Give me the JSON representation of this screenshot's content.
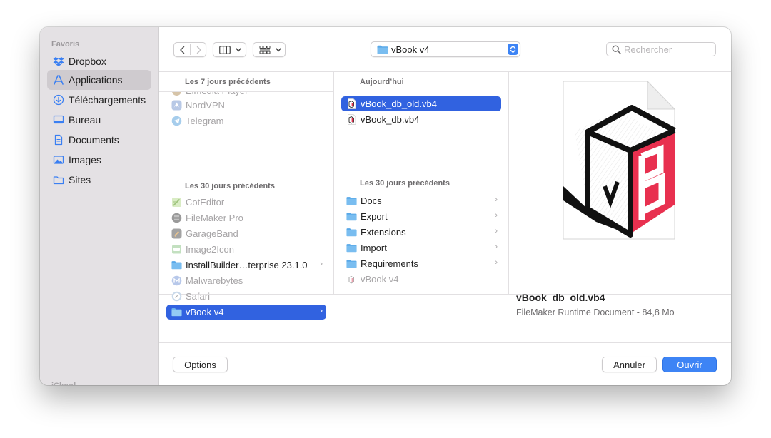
{
  "sidebar": {
    "header": "Favoris",
    "items": [
      {
        "label": "Dropbox",
        "icon": "dropbox-icon"
      },
      {
        "label": "Applications",
        "icon": "applications-icon",
        "selected": true
      },
      {
        "label": "Téléchargements",
        "icon": "downloads-icon"
      },
      {
        "label": "Bureau",
        "icon": "desktop-icon"
      },
      {
        "label": "Documents",
        "icon": "documents-icon"
      },
      {
        "label": "Images",
        "icon": "images-icon"
      },
      {
        "label": "Sites",
        "icon": "sites-folder-icon"
      }
    ],
    "next_header_partial": "iCloud"
  },
  "toolbar": {
    "back_icon": "chevron-left-icon",
    "forward_icon": "chevron-right-icon",
    "view_mode_icon": "columns-view-icon",
    "group_icon": "group-grid-icon",
    "path_label": "vBook v4",
    "search_placeholder": "Rechercher"
  },
  "column1": {
    "partial_item": "Elmedia Player",
    "section1": "Les 7 jours précédents",
    "recent_items": [
      {
        "label": "NordVPN",
        "icon": "nordvpn-app-icon",
        "dim": true
      },
      {
        "label": "Telegram",
        "icon": "telegram-app-icon",
        "dim": true
      }
    ],
    "section2": "Les 30 jours précédents",
    "items": [
      {
        "label": "CotEditor",
        "icon": "coteditor-app-icon",
        "dim": true
      },
      {
        "label": "FileMaker Pro",
        "icon": "filemaker-app-icon",
        "dim": true
      },
      {
        "label": "GarageBand",
        "icon": "garageband-app-icon",
        "dim": true
      },
      {
        "label": "Image2Icon",
        "icon": "image2icon-app-icon",
        "dim": true
      },
      {
        "label": "InstallBuilder…terprise 23.1.0",
        "icon": "folder-icon",
        "dim": false,
        "chevron": "›"
      },
      {
        "label": "Malwarebytes",
        "icon": "malwarebytes-app-icon",
        "dim": true
      },
      {
        "label": "Safari",
        "icon": "safari-app-icon",
        "dim": true
      },
      {
        "label": "vBook v4",
        "icon": "folder-icon",
        "selected": true,
        "chevron": "›"
      }
    ]
  },
  "column2": {
    "section1": "Aujourd’hui",
    "today_items": [
      {
        "label": "vBook_db_old.vb4",
        "icon": "vb4-file-icon",
        "selected": true
      },
      {
        "label": "vBook_db.vb4",
        "icon": "vb4-file-icon"
      }
    ],
    "section2": "Les 30 jours précédents",
    "items": [
      {
        "label": "Docs",
        "icon": "folder-icon",
        "chevron": "›"
      },
      {
        "label": "Export",
        "icon": "folder-icon",
        "chevron": "›"
      },
      {
        "label": "Extensions",
        "icon": "folder-icon",
        "chevron": "›"
      },
      {
        "label": "Import",
        "icon": "folder-icon",
        "chevron": "›"
      },
      {
        "label": "Requirements",
        "icon": "folder-icon",
        "chevron": "›"
      },
      {
        "label": "vBook v4",
        "icon": "vb4-file-icon",
        "dim": true
      }
    ]
  },
  "preview": {
    "filename": "vBook_db_old.vb4",
    "kind_size": "FileMaker Runtime Document - 84,8 Mo",
    "logo_letters": "vB"
  },
  "footer": {
    "options_label": "Options",
    "cancel_label": "Annuler",
    "open_label": "Ouvrir"
  },
  "colors": {
    "accent": "#3d84f5",
    "selection": "#3162e0",
    "sidebar_bg": "#e4e1e4",
    "folder_blue": "#58a8e8",
    "vbook_red": "#e8304f"
  }
}
